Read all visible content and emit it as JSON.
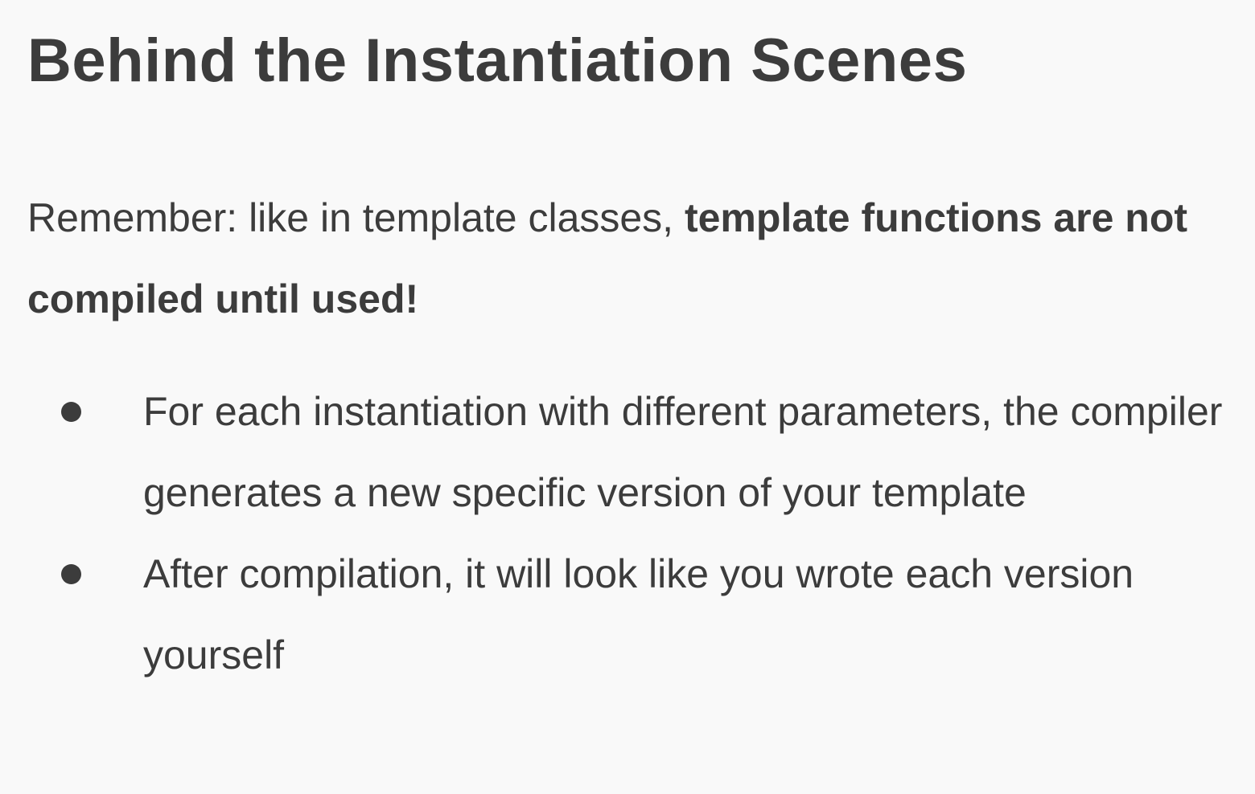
{
  "slide": {
    "title": "Behind the Instantiation Scenes",
    "intro": {
      "plain": "Remember: like in template classes, ",
      "bold": "template functions are not compiled until used!"
    },
    "bullets": [
      {
        "text": "For each instantiation with different parameters, the compiler generates a new specific version of your template"
      },
      {
        "text": "After compilation, it will look like you wrote each version yourself"
      }
    ]
  }
}
